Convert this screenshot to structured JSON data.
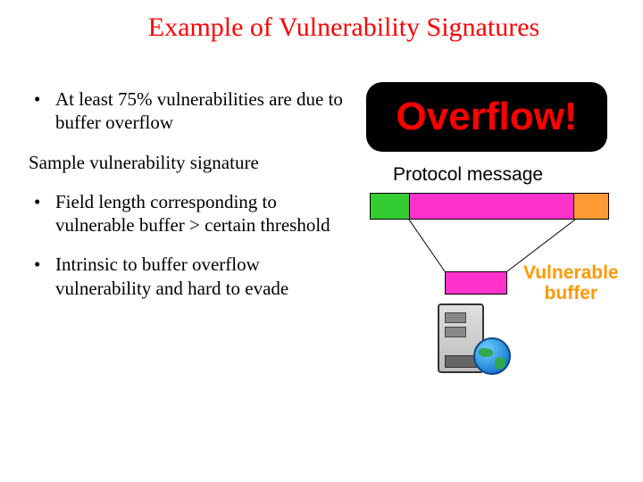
{
  "title": "Example of Vulnerability Signatures",
  "bullets": {
    "b1": "At least 75% vulnerabilities are due to buffer overflow",
    "subhead": "Sample vulnerability signature",
    "b2": "Field length corresponding to vulnerable buffer > certain threshold",
    "b3": "Intrinsic to buffer overflow vulnerability and hard to evade"
  },
  "overflow": "Overflow!",
  "proto_label": "Protocol message",
  "vuln_label_l1": "Vulnerable",
  "vuln_label_l2": "buffer"
}
